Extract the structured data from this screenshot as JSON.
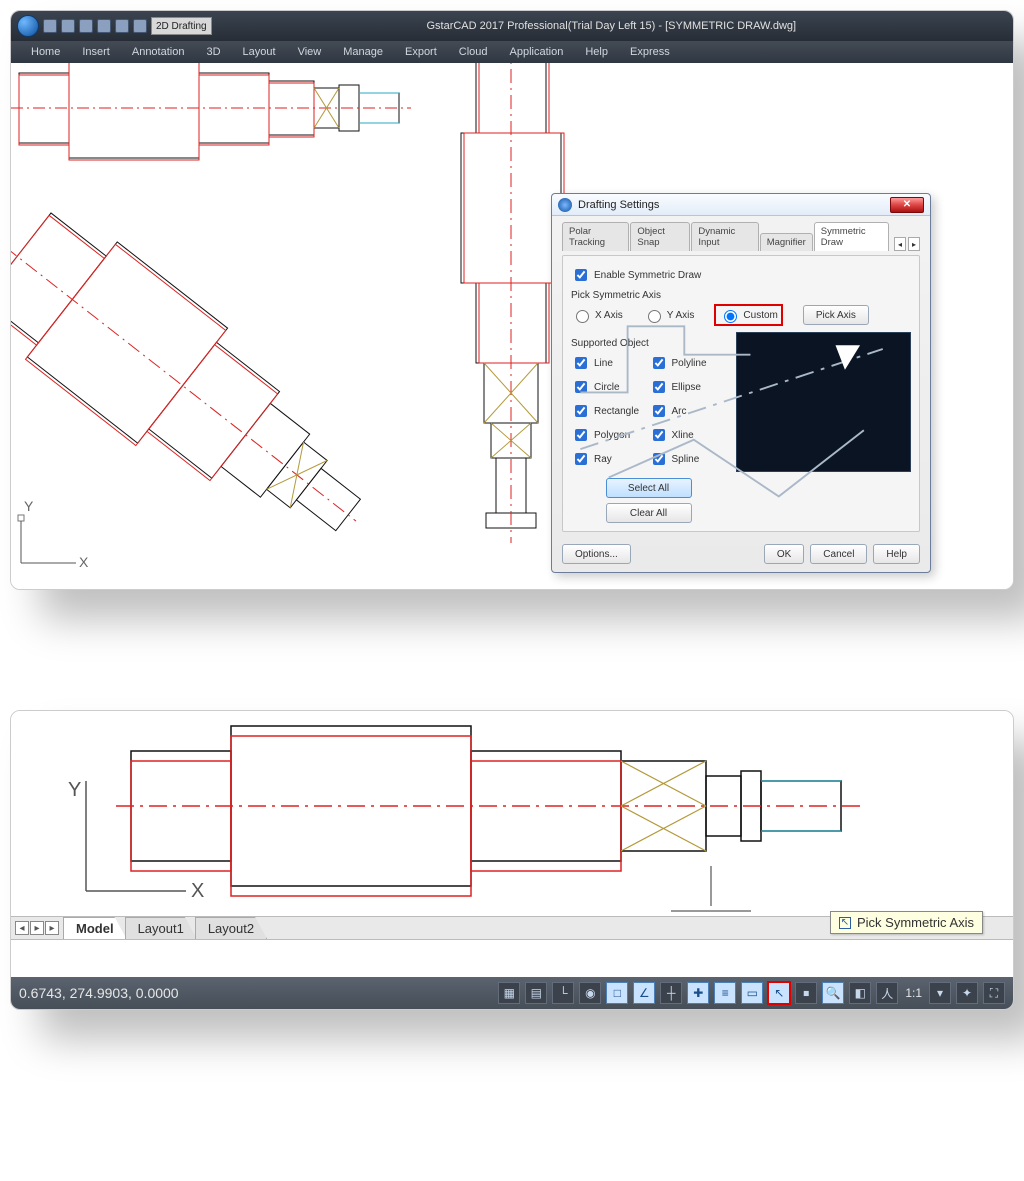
{
  "app": {
    "workspace": "2D Drafting",
    "title": "GstarCAD 2017 Professional(Trial Day Left 15) - [SYMMETRIC DRAW.dwg]"
  },
  "menubar": [
    "Home",
    "Insert",
    "Annotation",
    "3D",
    "Layout",
    "View",
    "Manage",
    "Export",
    "Cloud",
    "Application",
    "Help",
    "Express"
  ],
  "ucs": {
    "x": "X",
    "y": "Y"
  },
  "dialog": {
    "title": "Drafting Settings",
    "tabs": [
      "Polar Tracking",
      "Object Snap",
      "Dynamic Input",
      "Magnifier",
      "Symmetric Draw"
    ],
    "activeTab": "Symmetric Draw",
    "enable": "Enable Symmetric Draw",
    "pick_label": "Pick Symmetric Axis",
    "axis_options": {
      "x": "X Axis",
      "y": "Y Axis",
      "custom": "Custom"
    },
    "pick_axis_btn": "Pick Axis",
    "supported_label": "Supported Object",
    "supported": {
      "line": "Line",
      "polyline": "Polyline",
      "circle": "Circle",
      "ellipse": "Ellipse",
      "rectangle": "Rectangle",
      "arc": "Arc",
      "polygon": "Polygon",
      "xline": "Xline",
      "ray": "Ray",
      "spline": "Spline"
    },
    "select_all": "Select All",
    "clear_all": "Clear All",
    "options": "Options...",
    "ok": "OK",
    "cancel": "Cancel",
    "help": "Help"
  },
  "panel2": {
    "tabs": [
      "Model",
      "Layout1",
      "Layout2"
    ],
    "activeTab": "Model",
    "tooltip": "Pick Symmetric Axis",
    "coords": "0.6743, 274.9903, 0.0000",
    "scale": "1:1",
    "ucs": {
      "x": "X",
      "y": "Y"
    }
  }
}
